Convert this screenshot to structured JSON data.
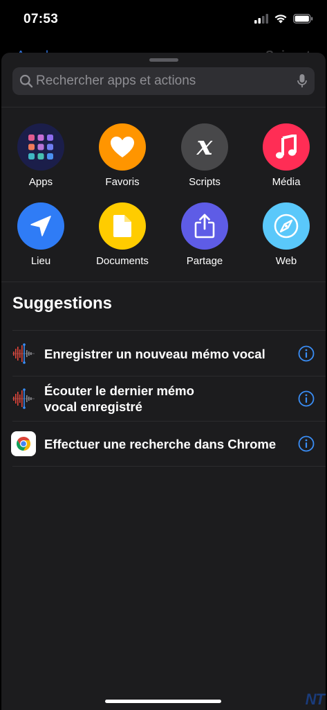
{
  "status_bar": {
    "time": "07:53"
  },
  "behind": {
    "left_label": "Annuler",
    "right_label": "Suivant"
  },
  "search": {
    "placeholder": "Rechercher apps et actions"
  },
  "categories": [
    {
      "label": "Apps",
      "icon": "apps-grid-icon",
      "color": "#1b1e4a"
    },
    {
      "label": "Favoris",
      "icon": "heart-icon",
      "color": "#ff9500"
    },
    {
      "label": "Scripts",
      "icon": "script-x-icon",
      "color": "#48484a"
    },
    {
      "label": "Média",
      "icon": "music-note-icon",
      "color": "#ff2d55"
    },
    {
      "label": "Lieu",
      "icon": "location-arrow-icon",
      "color": "#2f7cf6"
    },
    {
      "label": "Documents",
      "icon": "document-icon",
      "color": "#ffcc00"
    },
    {
      "label": "Partage",
      "icon": "share-icon",
      "color": "#5e5ce6"
    },
    {
      "label": "Web",
      "icon": "compass-icon",
      "color": "#5ac8fa"
    }
  ],
  "suggestions": {
    "title": "Suggestions",
    "items": [
      {
        "line1": "Enregistrer un nouveau mémo vocal",
        "line2": "",
        "icon": "voice-memo-icon"
      },
      {
        "line1": "Écouter le dernier mémo",
        "line2": "vocal enregistré",
        "icon": "voice-memo-icon"
      },
      {
        "line1": "Effectuer une recherche dans Chrome",
        "line2": "",
        "icon": "chrome-icon"
      }
    ]
  },
  "watermark": "NT"
}
